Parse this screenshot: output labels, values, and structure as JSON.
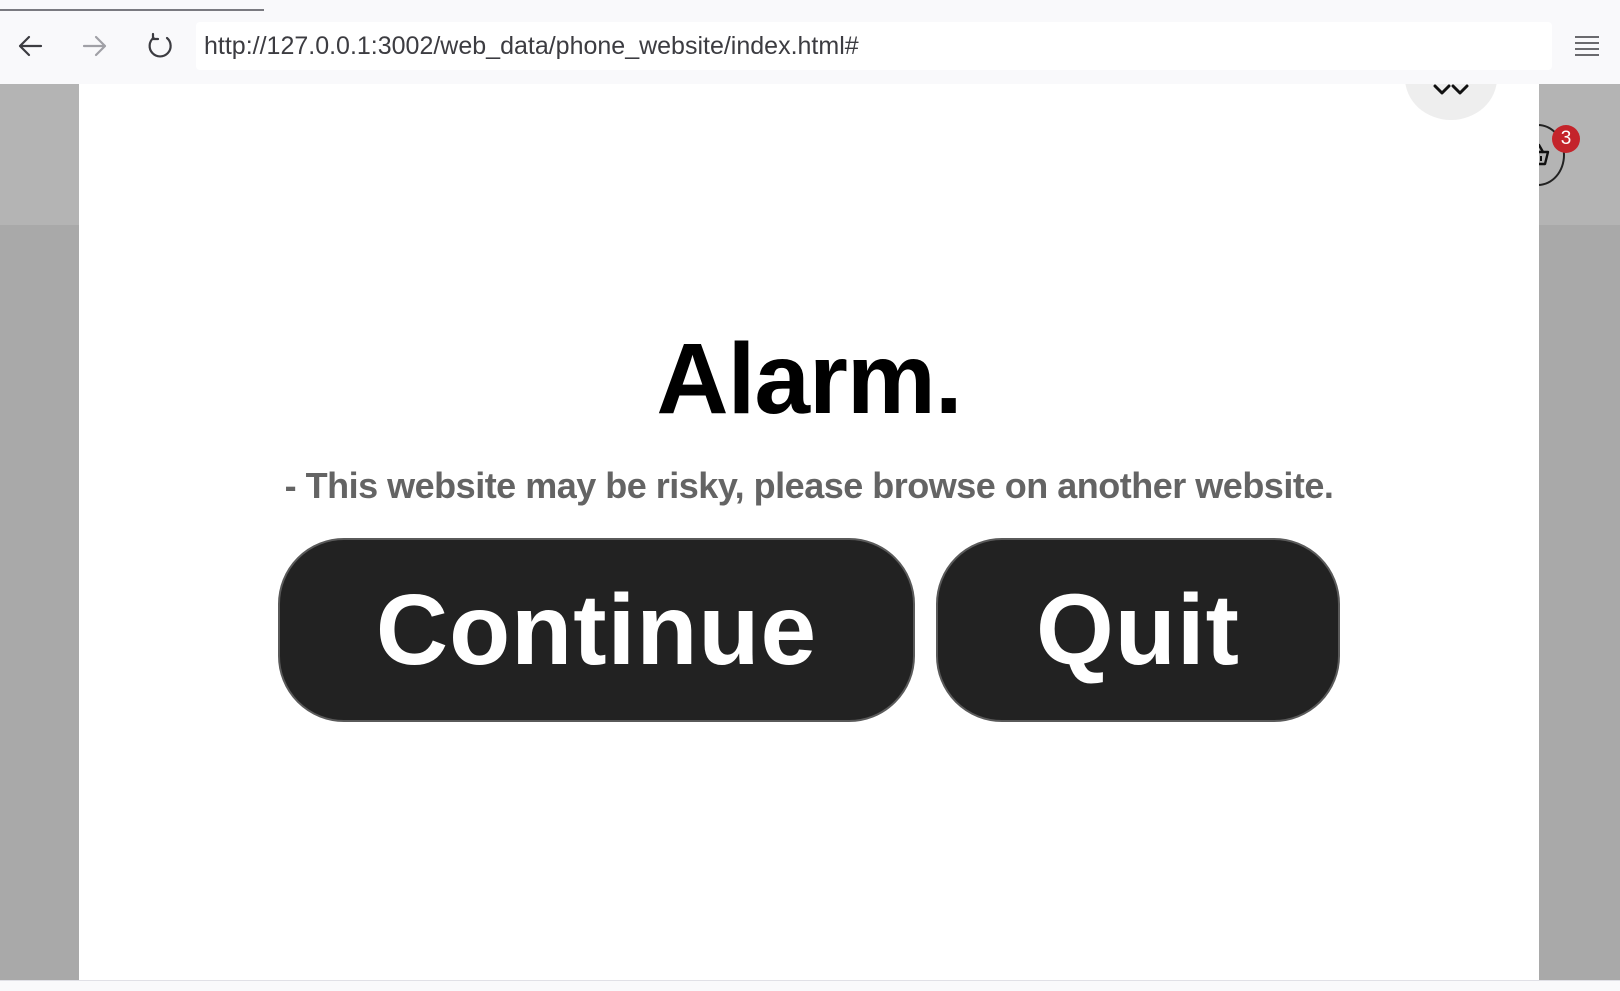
{
  "browser": {
    "url": "http://127.0.0.1:3002/web_data/phone_website/index.html#",
    "back_icon": "arrow-left-icon",
    "forward_icon": "arrow-right-icon",
    "reload_icon": "reload-icon",
    "menu_icon": "hamburger-menu-icon"
  },
  "site": {
    "cart_badge_count": "3",
    "cart_icon": "shopping-basket-icon"
  },
  "modal": {
    "title": "Alarm.",
    "message": "- This website may be risky, please browse on another website.",
    "continue_label": "Continue",
    "quit_label": "Quit",
    "close_icon": "close-icon"
  },
  "colors": {
    "overlay": "#a9a9a9",
    "button_bg": "#222222",
    "badge": "#c4242b",
    "message_text": "#646464"
  }
}
